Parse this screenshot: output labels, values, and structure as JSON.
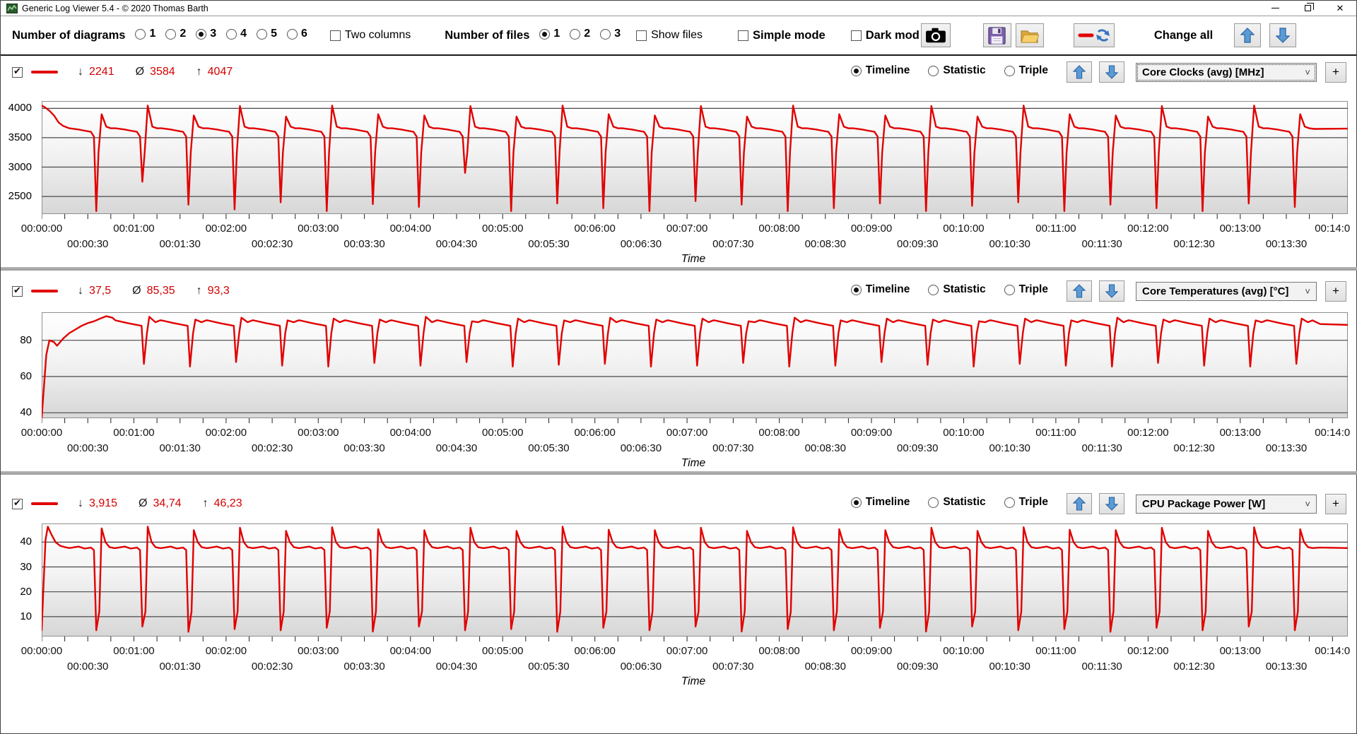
{
  "window": {
    "title": "Generic Log Viewer 5.4 - © 2020 Thomas Barth"
  },
  "toolbar": {
    "number_of_diagrams": {
      "label": "Number of diagrams",
      "options": [
        "1",
        "2",
        "3",
        "4",
        "5",
        "6"
      ],
      "selected": "3"
    },
    "two_columns": {
      "label": "Two columns",
      "checked": false
    },
    "number_of_files": {
      "label": "Number of files",
      "options": [
        "1",
        "2",
        "3"
      ],
      "selected": "1"
    },
    "show_files": {
      "label": "Show files",
      "checked": false
    },
    "simple_mode": {
      "label": "Simple mode",
      "checked": false
    },
    "dark_mode": {
      "label": "Dark mod",
      "checked": false
    },
    "change_all_label": "Change all"
  },
  "symbols": {
    "min": "↓",
    "avg": "Ø",
    "max": "↑"
  },
  "ui": {
    "time_label": "Time",
    "plus_label": "+",
    "views": [
      "Timeline",
      "Statistic",
      "Triple"
    ]
  },
  "panels": [
    {
      "visible": true,
      "stats": {
        "min": "2241",
        "avg": "3584",
        "max": "4047"
      },
      "selected_view": "Timeline",
      "series_name": "Core Clocks (avg) [MHz]",
      "focused_dropdown": true
    },
    {
      "visible": true,
      "stats": {
        "min": "37,5",
        "avg": "85,35",
        "max": "93,3"
      },
      "selected_view": "Timeline",
      "series_name": "Core Temperatures (avg) [°C]",
      "focused_dropdown": false
    },
    {
      "visible": true,
      "stats": {
        "min": "3,915",
        "avg": "34,74",
        "max": "46,23"
      },
      "selected_view": "Timeline",
      "series_name": "CPU Package Power [W]",
      "focused_dropdown": false
    }
  ],
  "chart_data": [
    {
      "type": "line",
      "name": "Core Clocks (avg) [MHz]",
      "color": "#e10000",
      "stats": {
        "min": 2241,
        "avg": 3584,
        "max": 4047
      },
      "x_axis": {
        "label": "Time",
        "range_s": [
          0,
          850
        ],
        "tick_interval_s": 15,
        "label_row1": [
          "00:00:00",
          "00:01:00",
          "00:02:00",
          "00:03:00",
          "00:04:00",
          "00:05:00",
          "00:06:00",
          "00:07:00",
          "00:08:00",
          "00:09:00",
          "00:10:00",
          "00:11:00",
          "00:12:00",
          "00:13:00",
          "00:14:0"
        ],
        "label_row2": [
          "00:00:30",
          "00:01:30",
          "00:02:30",
          "00:03:30",
          "00:04:30",
          "00:05:30",
          "00:06:30",
          "00:07:30",
          "00:08:30",
          "00:09:30",
          "00:10:30",
          "00:11:30",
          "00:12:30",
          "00:13:30"
        ]
      },
      "y_axis": {
        "ticks": [
          4000,
          3500,
          3000,
          2500
        ],
        "range": [
          2200,
          4125
        ]
      },
      "grid": true,
      "legend": "none",
      "waveform": {
        "start": [
          [
            0,
            4047
          ],
          [
            2,
            4020
          ],
          [
            5,
            3960
          ],
          [
            8,
            3880
          ],
          [
            11,
            3760
          ],
          [
            14,
            3700
          ],
          [
            18,
            3660
          ]
        ],
        "cycle": {
          "t0": 18,
          "period": 30,
          "count": 27,
          "points": [
            [
              0,
              3660
            ],
            [
              6,
              3640
            ],
            [
              10,
              3620
            ],
            [
              14,
              3600
            ],
            [
              16,
              3520
            ],
            [
              17.5,
              "DIP"
            ],
            [
              19,
              3250
            ],
            [
              21,
              "PEAK"
            ],
            [
              24,
              3690
            ],
            [
              27,
              3660
            ]
          ]
        },
        "peaks": [
          3900,
          4047,
          3880,
          4040,
          3860,
          4047,
          3900,
          3880,
          4040,
          3860,
          4047,
          3900,
          3880,
          4040,
          3860,
          4047,
          3900,
          3880,
          4040,
          3860,
          4047,
          3900,
          3880,
          4040,
          3860,
          4047,
          3900
        ],
        "dips": [
          2250,
          2750,
          2360,
          2280,
          2400,
          2250,
          2370,
          2320,
          2900,
          2250,
          2380,
          2300,
          2250,
          2420,
          2360,
          2250,
          2300,
          2380,
          2250,
          2340,
          2400,
          2250,
          2360,
          2300,
          2250,
          2380,
          2320
        ],
        "tail": [
          [
            828,
            3650
          ],
          [
            850,
            3655
          ]
        ]
      }
    },
    {
      "type": "line",
      "name": "Core Temperatures (avg) [°C]",
      "color": "#e10000",
      "stats": {
        "min": 37.5,
        "avg": 85.35,
        "max": 93.3
      },
      "x_axis": {
        "label": "Time",
        "range_s": [
          0,
          850
        ],
        "tick_interval_s": 15,
        "label_row1": [
          "00:00:00",
          "00:01:00",
          "00:02:00",
          "00:03:00",
          "00:04:00",
          "00:05:00",
          "00:06:00",
          "00:07:00",
          "00:08:00",
          "00:09:00",
          "00:10:00",
          "00:11:00",
          "00:12:00",
          "00:13:00",
          "00:14:0"
        ],
        "label_row2": [
          "00:00:30",
          "00:01:30",
          "00:02:30",
          "00:03:30",
          "00:04:30",
          "00:05:30",
          "00:06:30",
          "00:07:30",
          "00:08:30",
          "00:09:30",
          "00:10:30",
          "00:11:30",
          "00:12:30",
          "00:13:30"
        ]
      },
      "y_axis": {
        "ticks": [
          80,
          60,
          40
        ],
        "range": [
          37,
          95.5
        ]
      },
      "grid": true,
      "legend": "none",
      "waveform": {
        "start": [
          [
            0,
            37.5
          ],
          [
            1.5,
            55
          ],
          [
            3,
            72
          ],
          [
            5,
            80
          ],
          [
            8,
            79
          ],
          [
            10,
            77
          ],
          [
            14,
            81
          ],
          [
            18,
            84
          ],
          [
            22,
            86
          ],
          [
            26,
            88
          ],
          [
            30,
            89.5
          ],
          [
            34,
            90.5
          ],
          [
            38,
            92
          ],
          [
            42,
            93.3
          ],
          [
            46,
            92.5
          ]
        ],
        "cycle": {
          "t0": 48,
          "period": 30,
          "count": 26,
          "points": [
            [
              0,
              91
            ],
            [
              8,
              89.5
            ],
            [
              14,
              88.5
            ],
            [
              17,
              88
            ],
            [
              18.5,
              "DIP"
            ],
            [
              20.5,
              84
            ],
            [
              22,
              "PEAK"
            ],
            [
              26,
              90
            ],
            [
              29,
              91
            ]
          ]
        },
        "peaks": [
          93,
          91.5,
          92.5,
          91,
          92,
          91.5,
          93,
          90.5,
          92,
          91,
          92.5,
          91.5,
          92,
          90.5,
          92.5,
          91,
          92,
          91.5,
          90.5,
          92,
          91,
          92.5,
          91.5,
          92,
          91,
          92
        ],
        "dips": [
          67,
          65.5,
          68,
          66,
          65.5,
          67.5,
          66,
          68,
          65.5,
          66.5,
          67,
          65.5,
          66,
          67.5,
          65.5,
          66,
          68,
          66.5,
          65.5,
          67,
          66,
          65.5,
          67.5,
          66,
          65.5,
          67
        ],
        "tail": [
          [
            832,
            89
          ],
          [
            850,
            88.5
          ]
        ]
      }
    },
    {
      "type": "line",
      "name": "CPU Package Power [W]",
      "color": "#e10000",
      "stats": {
        "min": 3.915,
        "avg": 34.74,
        "max": 46.23
      },
      "x_axis": {
        "label": "Time",
        "range_s": [
          0,
          850
        ],
        "tick_interval_s": 15,
        "label_row1": [
          "00:00:00",
          "00:01:00",
          "00:02:00",
          "00:03:00",
          "00:04:00",
          "00:05:00",
          "00:06:00",
          "00:07:00",
          "00:08:00",
          "00:09:00",
          "00:10:00",
          "00:11:00",
          "00:12:00",
          "00:13:00",
          "00:14:0"
        ],
        "label_row2": [
          "00:00:30",
          "00:01:30",
          "00:02:30",
          "00:03:30",
          "00:04:30",
          "00:05:30",
          "00:06:30",
          "00:07:30",
          "00:08:30",
          "00:09:30",
          "00:10:30",
          "00:11:30",
          "00:12:30",
          "00:13:30"
        ]
      },
      "y_axis": {
        "ticks": [
          40,
          30,
          20,
          10
        ],
        "range": [
          2,
          47.5
        ]
      },
      "grid": true,
      "legend": "none",
      "waveform": {
        "start": [
          [
            0,
            4.5
          ],
          [
            1,
            20
          ],
          [
            2.5,
            41
          ],
          [
            4,
            46.23
          ],
          [
            6,
            43.5
          ],
          [
            9,
            40
          ],
          [
            12,
            38.5
          ],
          [
            15,
            38
          ],
          [
            18,
            37.6
          ]
        ],
        "cycle": {
          "t0": 18,
          "period": 30,
          "count": 27,
          "points": [
            [
              0,
              37.6
            ],
            [
              6,
              38.2
            ],
            [
              10,
              37.4
            ],
            [
              14,
              37.8
            ],
            [
              16,
              36.8
            ],
            [
              17.5,
              "DIP"
            ],
            [
              19.5,
              12
            ],
            [
              21,
              "PEAK"
            ],
            [
              23.5,
              40
            ],
            [
              26,
              38
            ],
            [
              29,
              37.6
            ]
          ]
        },
        "peaks": [
          45.5,
          46.23,
          44.8,
          45.8,
          44.5,
          46,
          45.2,
          44.8,
          45.8,
          44.5,
          46.23,
          45,
          44.8,
          45.8,
          44.5,
          46,
          45.2,
          44.8,
          45.8,
          44.5,
          46,
          45,
          44.8,
          45.8,
          44.5,
          46,
          45.2
        ],
        "dips": [
          4.5,
          6,
          3.915,
          5,
          4.5,
          5.5,
          4,
          6,
          4.5,
          5,
          3.915,
          5.5,
          4.5,
          6,
          4,
          5,
          4.5,
          5.5,
          4,
          6,
          4.5,
          5,
          3.915,
          5.5,
          4.5,
          6,
          4.5
        ],
        "tail": [
          [
            832,
            37.8
          ],
          [
            850,
            37.6
          ]
        ]
      }
    }
  ]
}
